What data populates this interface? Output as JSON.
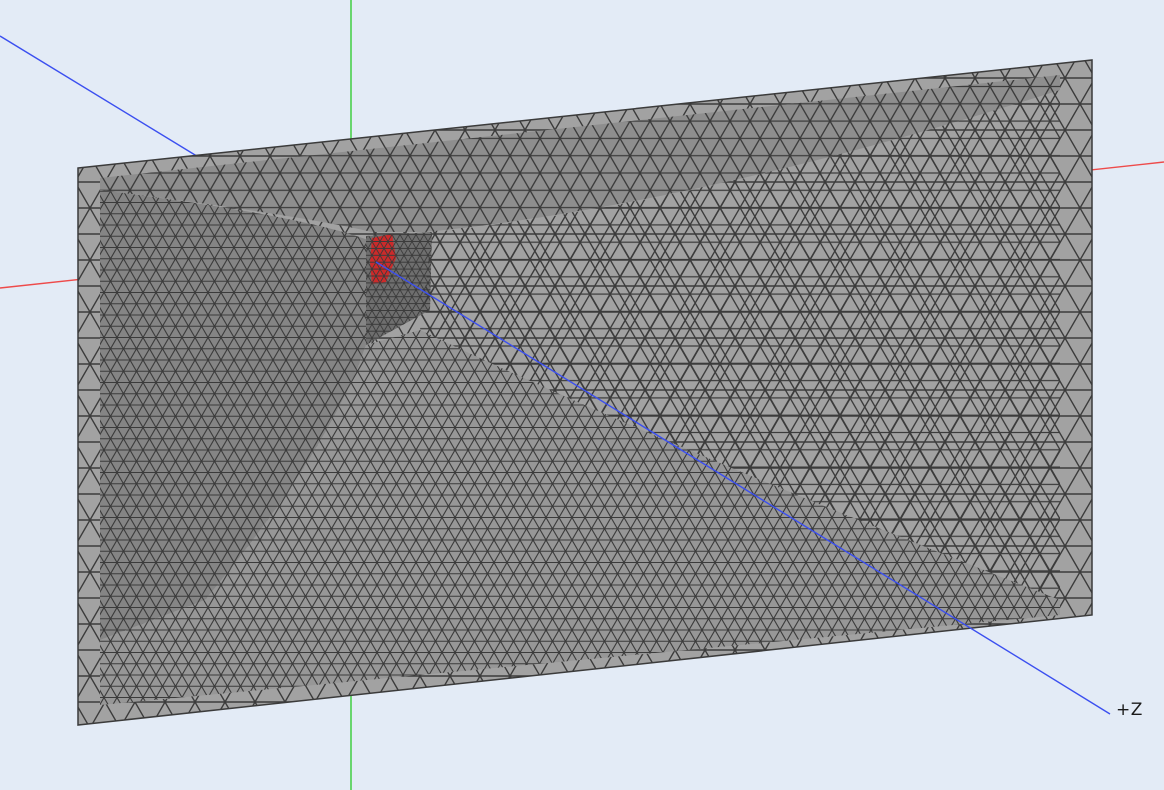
{
  "viewport": {
    "background": "#e3ebf6",
    "mesh": {
      "type": "triangulated-surface",
      "fill_color": "#a2a2a2",
      "wire_color": "#3b3b3b",
      "highlight_color": "#cc2a2a"
    },
    "axes": {
      "x": {
        "color": "#ee4a4a",
        "label": ""
      },
      "y": {
        "color": "#35cc35",
        "label": ""
      },
      "z": {
        "color": "#3b4ff0",
        "label": "+Z"
      }
    }
  }
}
